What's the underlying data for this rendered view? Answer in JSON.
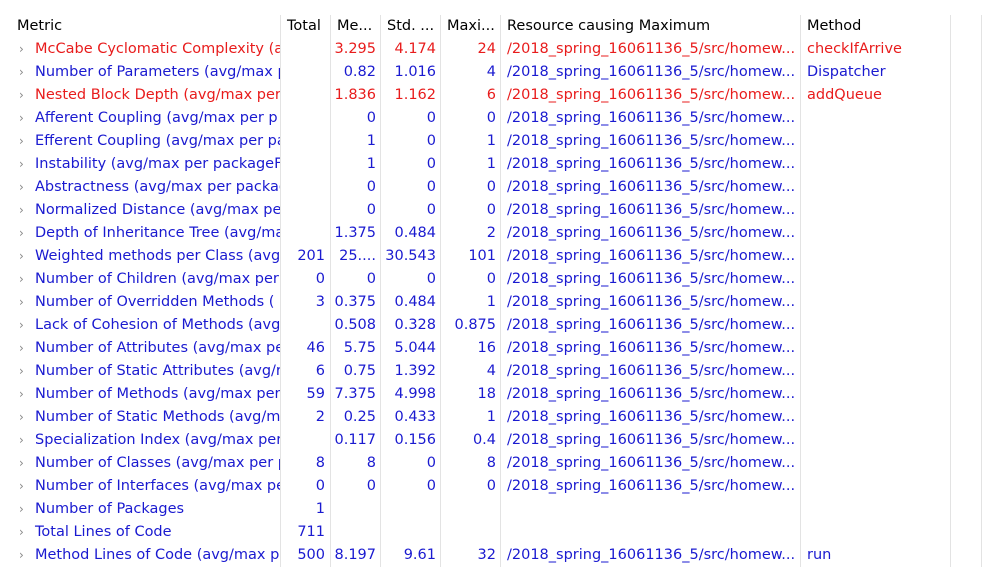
{
  "colors": {
    "normal": "#1a1ad0",
    "warning": "#e81c1c",
    "selected_row": "#e5f1fb"
  },
  "columns": [
    "Metric",
    "Total",
    "Me...",
    "Std. ...",
    "Maxi...",
    "Resource causing Maximum",
    "Method"
  ],
  "selected_row": 6,
  "rows": [
    {
      "metric": "McCabe Cyclomatic Complexity (a",
      "total": "",
      "mean": "3.295",
      "std": "4.174",
      "max": "24",
      "resource": "/2018_spring_16061136_5/src/homew...",
      "method": "checkIfArrive",
      "warn": true
    },
    {
      "metric": "Number of Parameters (avg/max p",
      "total": "",
      "mean": "0.82",
      "std": "1.016",
      "max": "4",
      "resource": "/2018_spring_16061136_5/src/homew...",
      "method": "Dispatcher",
      "warn": false
    },
    {
      "metric": "Nested Block Depth (avg/max per",
      "total": "",
      "mean": "1.836",
      "std": "1.162",
      "max": "6",
      "resource": "/2018_spring_16061136_5/src/homew...",
      "method": "addQueue",
      "warn": true
    },
    {
      "metric": "Afferent Coupling (avg/max per p",
      "total": "",
      "mean": "0",
      "std": "0",
      "max": "0",
      "resource": "/2018_spring_16061136_5/src/homew...",
      "method": "",
      "warn": false
    },
    {
      "metric": "Efferent Coupling (avg/max per pa",
      "total": "",
      "mean": "1",
      "std": "0",
      "max": "1",
      "resource": "/2018_spring_16061136_5/src/homew...",
      "method": "",
      "warn": false
    },
    {
      "metric": "Instability (avg/max per packageFr",
      "total": "",
      "mean": "1",
      "std": "0",
      "max": "1",
      "resource": "/2018_spring_16061136_5/src/homew...",
      "method": "",
      "warn": false
    },
    {
      "metric": "Abstractness (avg/max per packag",
      "total": "",
      "mean": "0",
      "std": "0",
      "max": "0",
      "resource": "/2018_spring_16061136_5/src/homew...",
      "method": "",
      "warn": false
    },
    {
      "metric": "Normalized Distance (avg/max pe",
      "total": "",
      "mean": "0",
      "std": "0",
      "max": "0",
      "resource": "/2018_spring_16061136_5/src/homew...",
      "method": "",
      "warn": false
    },
    {
      "metric": "Depth of Inheritance Tree (avg/ma",
      "total": "",
      "mean": "1.375",
      "std": "0.484",
      "max": "2",
      "resource": "/2018_spring_16061136_5/src/homew...",
      "method": "",
      "warn": false
    },
    {
      "metric": "Weighted methods per Class (avg",
      "total": "201",
      "mean": "25....",
      "std": "30.543",
      "max": "101",
      "resource": "/2018_spring_16061136_5/src/homew...",
      "method": "",
      "warn": false
    },
    {
      "metric": "Number of Children (avg/max per",
      "total": "0",
      "mean": "0",
      "std": "0",
      "max": "0",
      "resource": "/2018_spring_16061136_5/src/homew...",
      "method": "",
      "warn": false
    },
    {
      "metric": "Number of Overridden Methods (",
      "total": "3",
      "mean": "0.375",
      "std": "0.484",
      "max": "1",
      "resource": "/2018_spring_16061136_5/src/homew...",
      "method": "",
      "warn": false
    },
    {
      "metric": "Lack of Cohesion of Methods (avg",
      "total": "",
      "mean": "0.508",
      "std": "0.328",
      "max": "0.875",
      "resource": "/2018_spring_16061136_5/src/homew...",
      "method": "",
      "warn": false
    },
    {
      "metric": "Number of Attributes (avg/max pe",
      "total": "46",
      "mean": "5.75",
      "std": "5.044",
      "max": "16",
      "resource": "/2018_spring_16061136_5/src/homew...",
      "method": "",
      "warn": false
    },
    {
      "metric": "Number of Static Attributes (avg/r",
      "total": "6",
      "mean": "0.75",
      "std": "1.392",
      "max": "4",
      "resource": "/2018_spring_16061136_5/src/homew...",
      "method": "",
      "warn": false
    },
    {
      "metric": "Number of Methods (avg/max per",
      "total": "59",
      "mean": "7.375",
      "std": "4.998",
      "max": "18",
      "resource": "/2018_spring_16061136_5/src/homew...",
      "method": "",
      "warn": false
    },
    {
      "metric": "Number of Static Methods (avg/m",
      "total": "2",
      "mean": "0.25",
      "std": "0.433",
      "max": "1",
      "resource": "/2018_spring_16061136_5/src/homew...",
      "method": "",
      "warn": false
    },
    {
      "metric": "Specialization Index (avg/max per",
      "total": "",
      "mean": "0.117",
      "std": "0.156",
      "max": "0.4",
      "resource": "/2018_spring_16061136_5/src/homew...",
      "method": "",
      "warn": false
    },
    {
      "metric": "Number of Classes (avg/max per p",
      "total": "8",
      "mean": "8",
      "std": "0",
      "max": "8",
      "resource": "/2018_spring_16061136_5/src/homew...",
      "method": "",
      "warn": false
    },
    {
      "metric": "Number of Interfaces (avg/max pe",
      "total": "0",
      "mean": "0",
      "std": "0",
      "max": "0",
      "resource": "/2018_spring_16061136_5/src/homew...",
      "method": "",
      "warn": false
    },
    {
      "metric": "Number of Packages",
      "total": "1",
      "mean": "",
      "std": "",
      "max": "",
      "resource": "",
      "method": "",
      "warn": false
    },
    {
      "metric": "Total Lines of Code",
      "total": "711",
      "mean": "",
      "std": "",
      "max": "",
      "resource": "",
      "method": "",
      "warn": false
    },
    {
      "metric": "Method Lines of Code (avg/max p",
      "total": "500",
      "mean": "8.197",
      "std": "9.61",
      "max": "32",
      "resource": "/2018_spring_16061136_5/src/homew...",
      "method": "run",
      "warn": false
    }
  ]
}
